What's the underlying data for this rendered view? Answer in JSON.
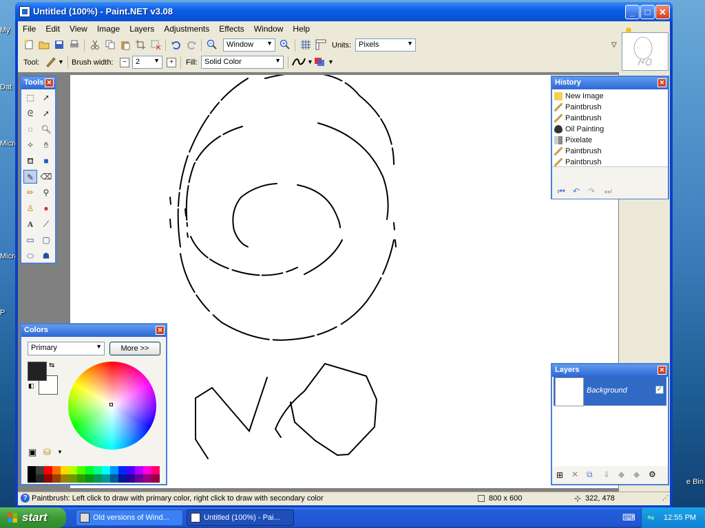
{
  "window": {
    "title": "Untitled (100%) - Paint.NET v3.08",
    "controls": {
      "minimize": "_",
      "maximize": "□",
      "close": "✕"
    }
  },
  "menu": [
    "File",
    "Edit",
    "View",
    "Image",
    "Layers",
    "Adjustments",
    "Effects",
    "Window",
    "Help"
  ],
  "toolbar": {
    "zoom_value": "Window",
    "units_label": "Units:",
    "units_value": "Pixels"
  },
  "toolbar2": {
    "tool_label": "Tool:",
    "brush_width_label": "Brush width:",
    "brush_width_value": "2",
    "fill_label": "Fill:",
    "fill_value": "Solid Color"
  },
  "tools_panel": {
    "title": "Tools",
    "close": "✕"
  },
  "history_panel": {
    "title": "History",
    "close": "✕",
    "items": [
      "New Image",
      "Paintbrush",
      "Paintbrush",
      "Oil Painting",
      "Pixelate",
      "Paintbrush",
      "Paintbrush"
    ]
  },
  "colors_panel": {
    "title": "Colors",
    "close": "✕",
    "mode_value": "Primary",
    "more_label": "More >>",
    "primary_color": "#222222",
    "secondary_color": "#ffffff",
    "palette": [
      "#000000",
      "#404040",
      "#ff0000",
      "#ff6a00",
      "#ffd800",
      "#b6ff00",
      "#4cff00",
      "#00ff21",
      "#00ff90",
      "#00ffff",
      "#0094ff",
      "#0026ff",
      "#4800ff",
      "#b200ff",
      "#ff00dc",
      "#ff006e"
    ]
  },
  "layers_panel": {
    "title": "Layers",
    "close": "✕",
    "layer_name": "Background",
    "layer_visible": true
  },
  "statusbar": {
    "message": "Paintbrush: Left click to draw with primary color, right click to draw with secondary color",
    "image_size": "800 x 600",
    "cursor_pos": "322, 478"
  },
  "taskbar": {
    "start_label": "start",
    "tasks": [
      "Old versions of Wind...",
      "Untitled (100%) - Pai..."
    ],
    "clock": "12:55 PM"
  },
  "desktop": {
    "icons": [
      "My",
      "Dat",
      "Micro\nC",
      "Micro\nB",
      "P"
    ],
    "recycle_bin": "e Bin"
  },
  "colors": {
    "title_blue": "#0b5ee8",
    "selection": "#316ac5",
    "panel_border": "#4a7fd6"
  }
}
